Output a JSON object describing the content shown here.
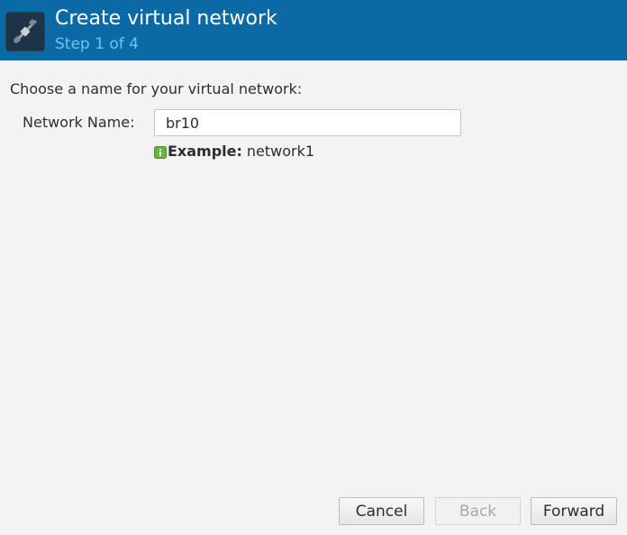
{
  "header": {
    "title": "Create virtual network",
    "subtitle": "Step 1 of 4",
    "icon": "network-cable-icon",
    "background_color": "#0b6aa6",
    "subtitle_color": "#6ec4f0"
  },
  "form": {
    "prompt": "Choose a name for your virtual network:",
    "network_name_label": "Network Name:",
    "network_name_value": "br10",
    "hint_icon": "info-icon",
    "hint_bold": "Example:",
    "hint_text": "network1"
  },
  "buttons": {
    "cancel_label": "Cancel",
    "back_label": "Back",
    "forward_label": "Forward",
    "back_enabled": false
  }
}
